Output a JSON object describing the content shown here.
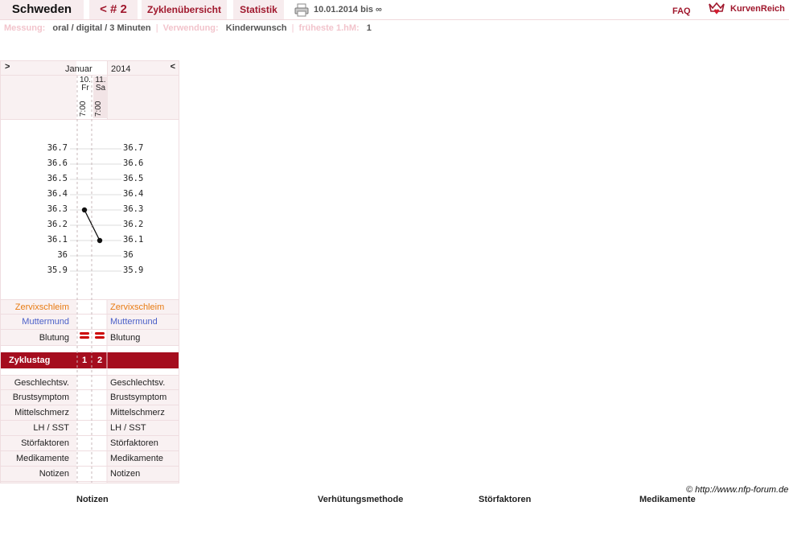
{
  "topbar": {
    "name": "Schweden",
    "cycle": "< # 2",
    "overview": "Zyklenübersicht",
    "stats": "Statistik",
    "date_range": "10.01.2014 bis ∞",
    "faq": "FAQ",
    "brand": "KurvenReich",
    "print_icon": "printer-icon",
    "brand_icon": "crown-heart-icon"
  },
  "info": {
    "messung_label": "Messung:",
    "messung_value": "oral / digital / 3 Minuten",
    "verwendung_label": "Verwendung:",
    "verwendung_value": "Kinderwunsch",
    "frueheste_label": "früheste 1.hM:",
    "frueheste_value": "1"
  },
  "chart": {
    "nav_prev": ">",
    "nav_next": "<",
    "month": "Januar",
    "year": "2014",
    "days": [
      {
        "date": "10.",
        "weekday": "Fr",
        "time": "7:00"
      },
      {
        "date": "11.",
        "weekday": "Sa",
        "time": "7:00"
      }
    ],
    "temp_labels": [
      "36.7",
      "36.6",
      "36.5",
      "36.4",
      "36.3",
      "36.2",
      "36.1",
      "36",
      "35.9"
    ],
    "zervix_label": "Zervixschleim",
    "muttermund_label": "Muttermund",
    "blutung_label": "Blutung",
    "zyklustag_label": "Zyklustag",
    "zyklustage": [
      "1",
      "2"
    ],
    "rows": [
      "Geschlechtsv.",
      "Brustsymptom",
      "Mittelschmerz",
      "LH / SST",
      "Störfaktoren",
      "Medikamente",
      "Notizen"
    ],
    "colors": {
      "zervix": "#e87b12",
      "muttermund": "#4a5fc8",
      "blutung": "#cc0000",
      "zyklus_bg": "#a50d1e"
    }
  },
  "chart_data": {
    "type": "line",
    "x": [
      "10.",
      "11."
    ],
    "series": [
      {
        "values": [
          36.3,
          36.1
        ]
      }
    ],
    "ylim": [
      35.9,
      36.7
    ],
    "grid": true
  },
  "footer": {
    "copyright": "© http://www.nfp-forum.de",
    "headers": [
      "Notizen",
      "Verhütungsmethode",
      "Störfaktoren",
      "Medikamente"
    ]
  }
}
